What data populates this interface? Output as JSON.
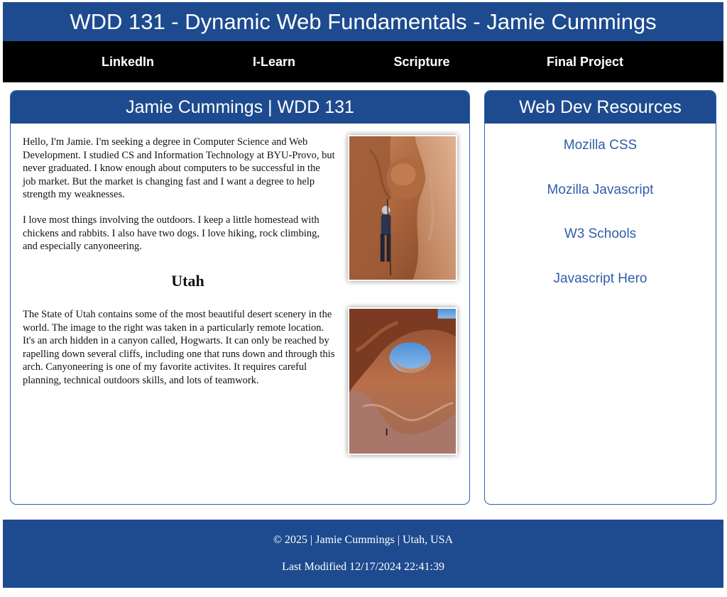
{
  "header": {
    "title": "WDD 131 - Dynamic Web Fundamentals - Jamie Cummings"
  },
  "nav": {
    "items": [
      {
        "label": "LinkedIn"
      },
      {
        "label": "I-Learn"
      },
      {
        "label": "Scripture"
      },
      {
        "label": "Final Project"
      }
    ]
  },
  "main": {
    "title": "Jamie Cummings | WDD 131",
    "intro": "Hello, I'm Jamie. I'm seeking a degree in Computer Science and Web Development. I studied CS and Information Technology at BYU-Provo, but never graduated. I know enough about computers to be successful in the job market. But the market is changing fast and I want a degree to help strength my weaknesses.",
    "outdoors": "I love most things involving the outdoors. I keep a little homestead with chickens and rabbits. I also have two dogs. I love hiking, rock climbing, and especially canyoneering.",
    "section_heading": "Utah",
    "utah_text": "The State of Utah contains some of the most beautiful desert scenery in the world. The image to the right was taken in a particularly remote location. It's an arch hidden in a canyon called, Hogwarts. It can only be reached by rapelling down several cliffs, including one that runs down and through this arch. Canyoneering is one of my favorite activites. It requires careful planning, technical outdoors skills, and lots of teamwork."
  },
  "sidebar": {
    "title": "Web Dev Resources",
    "links": [
      {
        "label": "Mozilla CSS"
      },
      {
        "label": "Mozilla Javascript"
      },
      {
        "label": "W3 Schools"
      },
      {
        "label": "Javascript Hero"
      }
    ]
  },
  "footer": {
    "copyright": "© 2025 | Jamie Cummings | Utah, USA",
    "last_modified": "Last Modified 12/17/2024 22:41:39"
  },
  "colors": {
    "brand_blue": "#1e4b8f",
    "nav_black": "#000000",
    "link_blue": "#2f5ea8"
  }
}
